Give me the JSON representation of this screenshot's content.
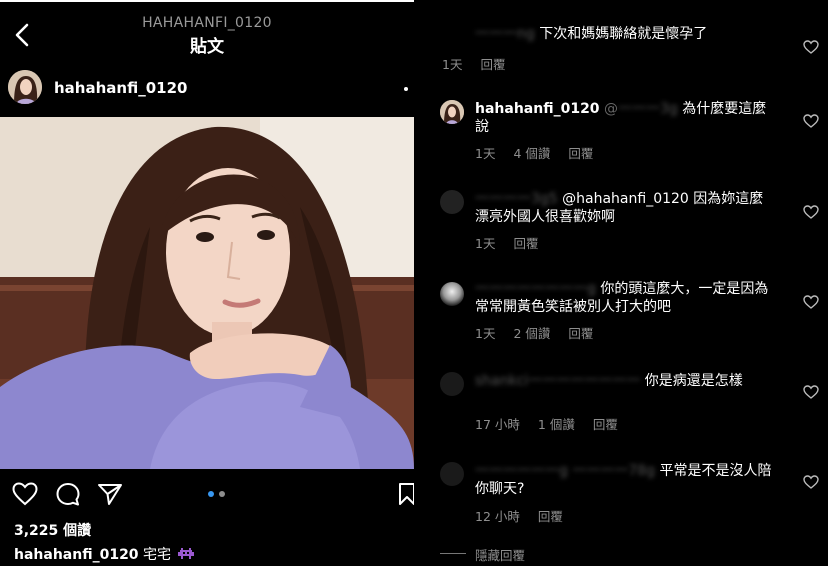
{
  "post": {
    "header_username": "HAHAHANFI_0120",
    "header_title": "貼文",
    "username": "hahahanfi_0120",
    "likes": "3,225 個讚",
    "caption_user": "hahahanfi_0120",
    "caption_text": "宅宅",
    "carousel": {
      "count": 2,
      "active": 1
    }
  },
  "comments": [
    {
      "user": "",
      "user_blurred": "一一一ng",
      "mention": "",
      "mention_blurred": "",
      "text": "下次和媽媽聯絡就是懷孕了",
      "time": "1天",
      "reply_count": "",
      "reply": "回覆"
    },
    {
      "user": "hahahanfi_0120",
      "user_blurred": "",
      "mention": "@",
      "mention_blurred": "一一一3g",
      "text": "為什麼要這麼說",
      "time": "1天",
      "reply_count": "4 個讚",
      "reply": "回覆"
    },
    {
      "user": "",
      "user_blurred": "一一一一3g5",
      "mention": "@hahahanfi_0120",
      "mention_blurred": "",
      "text": "因為妳這麼漂亮外國人很喜歡妳啊",
      "time": "1天",
      "reply_count": "",
      "reply": "回覆"
    },
    {
      "user": "",
      "user_blurred": "一一一一一一一一g",
      "mention": "",
      "mention_blurred": "",
      "text": "你的頭這麼大，一定是因為常常開黃色笑話被別人打大的吧",
      "time": "1天",
      "reply_count": "2 個讚",
      "reply": "回覆"
    },
    {
      "user": "",
      "user_blurred": "shankci一一一一一一一一",
      "mention": "",
      "mention_blurred": "",
      "text": "你是病還是怎樣",
      "time": "17 小時",
      "reply_count": "1 個讚",
      "reply": "回覆"
    },
    {
      "user": "",
      "user_blurred": "一一一一一一g 一一一一78g",
      "mention": "",
      "mention_blurred": "",
      "text": "平常是不是沒人陪你聊天?",
      "time": "12 小時",
      "reply_count": "",
      "reply": "回覆"
    }
  ],
  "hide_replies": "隱藏回覆",
  "colors": {
    "background": "#000000",
    "muted": "#8e8e8e",
    "carousel_active": "#3897f0"
  },
  "icons": [
    "back-arrow-icon",
    "more-icon",
    "heart-icon",
    "comment-icon",
    "share-icon",
    "bookmark-icon"
  ]
}
